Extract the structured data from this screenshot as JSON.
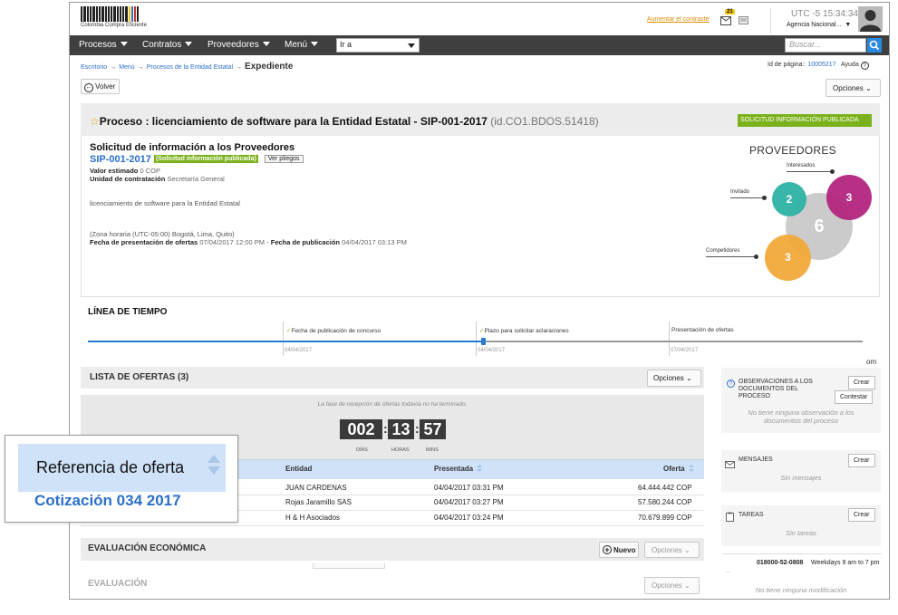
{
  "header": {
    "logo_text": "Colombia Compra Eficiente",
    "contrast_link": "Aumentar el contraste",
    "mail_badge": "21",
    "utc_label": "UTC -5",
    "utc_time": "15:34:34",
    "agency": "Agencia Nacional..."
  },
  "nav": {
    "items": [
      "Procesos",
      "Contratos",
      "Proveedores",
      "Menú"
    ],
    "goto": "Ir a",
    "search_placeholder": "Buscar..."
  },
  "breadcrumb": {
    "items": [
      "Escritorio",
      "Menú",
      "Procesos de la Entidad Estatal"
    ],
    "current": "Expediente"
  },
  "page_id": {
    "label": "Id de página::",
    "value": "10005217",
    "help": "Ayuda",
    "help_icon": "?"
  },
  "buttons": {
    "back": "Volver",
    "options": "Opciones",
    "create": "Crear",
    "reply": "Contestar",
    "new": "Nuevo"
  },
  "process": {
    "star": "☆",
    "title": "Proceso : licenciamiento de software para la Entidad Estatal - SIP-001-2017",
    "id": "(id.CO1.BDOS.51418)",
    "status": "SOLICITUD INFORMACIÓN PUBLICADA",
    "heading": "Solicitud de información a los Proveedores",
    "reference": "SIP-001-2017",
    "published_badge": "(Solicitud información publicada)",
    "docs_button": "Ver pliegos",
    "estimated_label": "Valor estimado",
    "estimated_value": "0 COP",
    "unit_label": "Unidad de contratación",
    "unit_value": "Secretaría General",
    "description": "licenciamiento de software para la Entidad Estatal",
    "timezone": "(Zona horaria (UTC-05:00) Bogotá, Lima, Quito)",
    "offers_date_label": "Fecha de presentación de ofertas",
    "offers_date": "07/04/2017 12:00 PM",
    "sep": "-",
    "pub_date_label": "Fecha de publicación",
    "pub_date": "04/04/2017 03:13 PM"
  },
  "providers": {
    "title": "PROVEEDORES",
    "interested_label": "Interesados",
    "invited_label": "Invitado",
    "competitors_label": "Competidores",
    "total": "6",
    "invited": "2",
    "interested": "3",
    "competitors": "3",
    "colors": {
      "invited": "#2fb3a6",
      "interested": "#b3267f",
      "competitors": "#f2a93b",
      "total": "#c9c9c9"
    }
  },
  "timeline": {
    "title": "LÍNEA DE TIEMPO",
    "events": [
      {
        "check": "✓",
        "label": "Fecha de publicación de concurso",
        "date": "04/04/2017"
      },
      {
        "check": "✓",
        "label": "Plazo para solicitar aclaraciones",
        "date": "04/04/2017"
      },
      {
        "check": "",
        "label": "Presentación de ofertas",
        "date": "07/04/2017"
      }
    ],
    "progress": 0.51
  },
  "offers": {
    "title": "LISTA DE OFERTAS (3)",
    "phase_message": "La fase de recepción de ofertas todavía no ha terminado.",
    "countdown": {
      "days": "002",
      "hours": "13",
      "mins": "57",
      "sep": ":",
      "days_label": "DÍAS",
      "hours_label": "HORAS",
      "mins_label": "MINS"
    },
    "columns": {
      "entity": "Entidad",
      "submitted": "Presentada",
      "offer": "Oferta"
    },
    "rows": [
      {
        "entity": "JUAN CARDENAS",
        "submitted": "04/04/2017 03:31 PM",
        "offer": "64.444.442 COP"
      },
      {
        "entity": "Rojas Jaramillo SAS",
        "submitted": "04/04/2017 03:27 PM",
        "offer": "57.580.244 COP"
      },
      {
        "entity": "H & H Asociados",
        "submitted": "04/04/2017 03:24 PM",
        "offer": "70.679.899 COP"
      }
    ]
  },
  "economic_eval": {
    "title": "EVALUACIÓN ECONÓMICA"
  },
  "evaluation": {
    "title": "EVALUACIÓN"
  },
  "sidebar": {
    "clipped": "om",
    "observations": {
      "icon": "?",
      "title": "OBSERVACIONES A LOS DOCUMENTOS DEL PROCESO",
      "empty": "No tiene ninguna observación a los documentos del proceso"
    },
    "messages": {
      "title": "MENSAJES",
      "empty": "Sin mensajes"
    },
    "tasks": {
      "title": "TAREAS",
      "empty": "Sin tareas"
    },
    "support": {
      "phone": "018000-52-0808",
      "hours": "Weekdays 9 am to 7 pm",
      "ellipsis": "..."
    },
    "modifications_empty": "No tiene ninguna modificación"
  },
  "zoom": {
    "header": "Referencia de oferta",
    "value": "Cotización 034 2017"
  }
}
